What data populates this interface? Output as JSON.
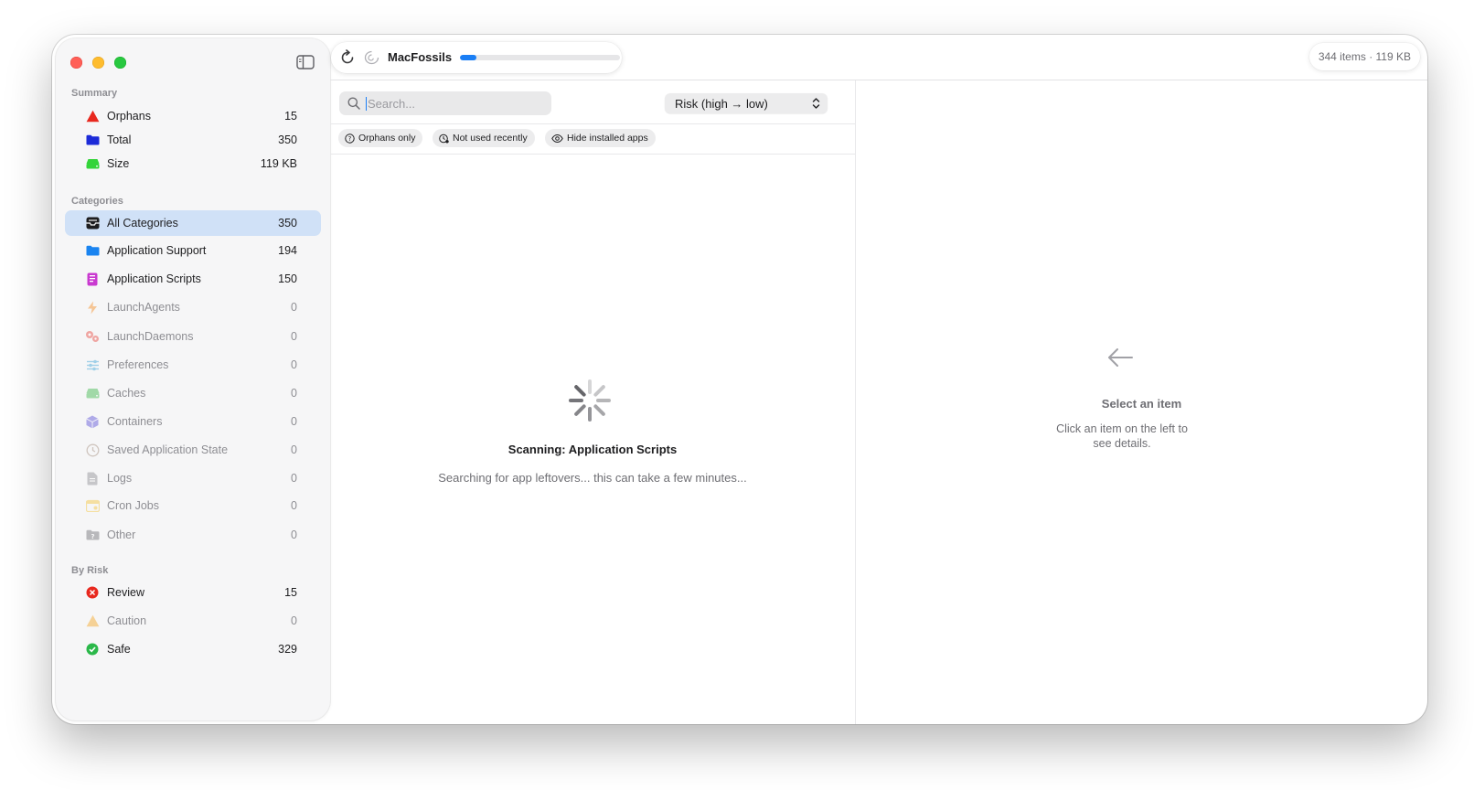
{
  "app": {
    "title": "MacFossils",
    "progress": 0.1
  },
  "stats": "344 items · 119 KB",
  "sidebar": {
    "summary_header": "Summary",
    "summary": [
      {
        "label": "Orphans",
        "count": "15",
        "icon": "warning-triangle-icon",
        "color": "#e8281e"
      },
      {
        "label": "Total",
        "count": "350",
        "icon": "folder-icon",
        "color": "#1c2bd8"
      },
      {
        "label": "Size",
        "count": "119 KB",
        "icon": "drive-icon",
        "color": "#34d43a"
      }
    ],
    "categories_header": "Categories",
    "categories": [
      {
        "label": "All Categories",
        "count": "350",
        "icon": "tray-stack-icon",
        "selected": true
      },
      {
        "label": "Application Support",
        "count": "194",
        "icon": "folder-icon",
        "color": "#1a84f0"
      },
      {
        "label": "Application Scripts",
        "count": "150",
        "icon": "scroll-icon",
        "color": "#c93ad0"
      },
      {
        "label": "LaunchAgents",
        "count": "0",
        "icon": "bolt-icon",
        "color": "#f58b1f"
      },
      {
        "label": "LaunchDaemons",
        "count": "0",
        "icon": "gears-icon",
        "color": "#e8453c"
      },
      {
        "label": "Preferences",
        "count": "0",
        "icon": "sliders-icon",
        "color": "#3aa3d8"
      },
      {
        "label": "Caches",
        "count": "0",
        "icon": "drive-icon",
        "color": "#3cb84a"
      },
      {
        "label": "Containers",
        "count": "0",
        "icon": "cube-icon",
        "color": "#5a4fd6"
      },
      {
        "label": "Saved Application State",
        "count": "0",
        "icon": "clock-icon",
        "color": "#a08a7a"
      },
      {
        "label": "Logs",
        "count": "0",
        "icon": "document-icon",
        "color": "#8e8e93"
      },
      {
        "label": "Cron Jobs",
        "count": "0",
        "icon": "calendar-icon",
        "color": "#f5c43a"
      },
      {
        "label": "Other",
        "count": "0",
        "icon": "folder-question-icon",
        "color": "#6e6e73"
      }
    ],
    "risk_header": "By Risk",
    "risk": [
      {
        "label": "Review",
        "count": "15",
        "icon": "x-circle-icon",
        "color": "#e8281e"
      },
      {
        "label": "Caution",
        "count": "0",
        "icon": "warning-triangle-icon",
        "color": "#f5a623"
      },
      {
        "label": "Safe",
        "count": "329",
        "icon": "check-circle-icon",
        "color": "#2bb84a"
      }
    ]
  },
  "search": {
    "placeholder": "Search...",
    "value": ""
  },
  "sort": {
    "selected": "Risk (high → low)"
  },
  "filters": [
    {
      "label": "Orphans only",
      "icon": "question-circle-icon"
    },
    {
      "label": "Not used recently",
      "icon": "clock-badge-icon"
    },
    {
      "label": "Hide installed apps",
      "icon": "eye-slash-icon"
    }
  ],
  "scan": {
    "title": "Scanning: Application Scripts",
    "subtitle": "Searching for app leftovers... this can take a few minutes..."
  },
  "detail": {
    "title": "Select an item",
    "subtitle": "Click an item on the left to see details."
  }
}
